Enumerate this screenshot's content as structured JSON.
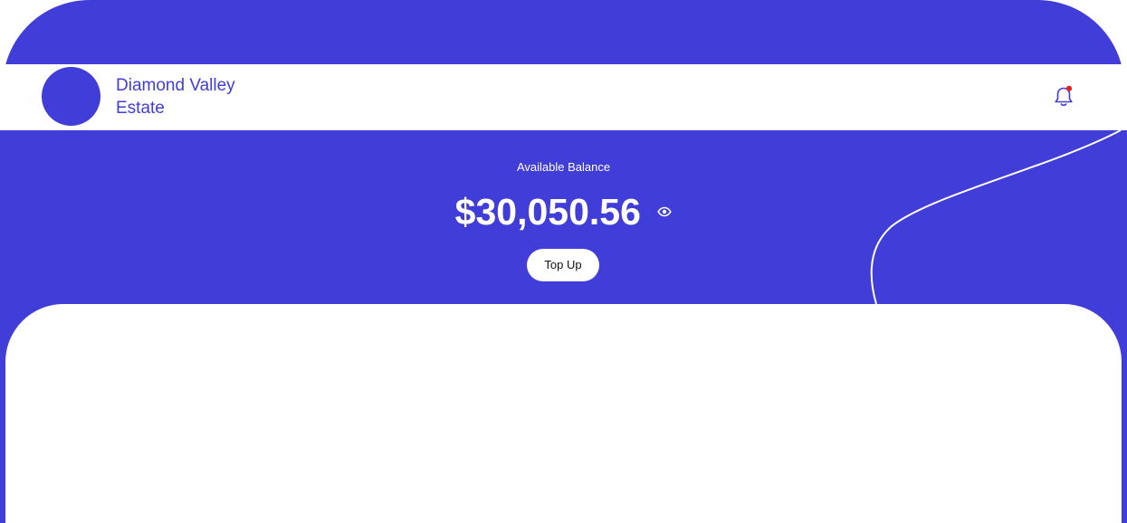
{
  "header": {
    "estate_name": "Diamond Valley Estate",
    "avatar_icon": "estate-avatar",
    "notification_icon": "bell-icon",
    "notification_badge_color": "#e02020"
  },
  "balance": {
    "label": "Available Balance",
    "amount": "$30,050.56",
    "visibility_icon": "eye-icon"
  },
  "actions": {
    "top_up_label": "Top Up"
  },
  "theme": {
    "primary": "#413dd8",
    "surface": "#ffffff"
  }
}
